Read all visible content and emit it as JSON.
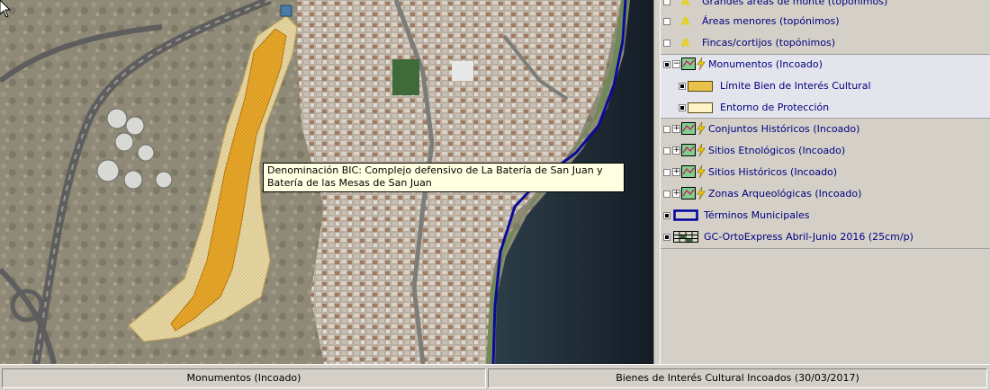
{
  "map": {
    "tooltip": "Denominación BIC: Complejo defensivo de La Batería de San Juan y Batería de las Mesas de San Juan"
  },
  "layers": [
    {
      "label": "Grandes áreas de monte (topónimos)",
      "icon": "font-a-icon",
      "checked": false
    },
    {
      "label": "Áreas menores (topónimos)",
      "icon": "font-a-icon",
      "checked": false
    },
    {
      "label": "Fincas/cortijos (topónimos)",
      "icon": "font-a-icon",
      "checked": false
    },
    {
      "label": "Monumentos (Incoado)",
      "icon": "polygon-layer-icon",
      "checked": true,
      "expanded": true
    },
    {
      "label": "Límite Bien de Interés Cultural",
      "icon": "legend-swatch-icon",
      "checked": true,
      "swatch": "#e8c24a"
    },
    {
      "label": "Entorno de Protección",
      "icon": "legend-swatch-icon",
      "checked": true,
      "swatch": "#fff4c8"
    },
    {
      "label": "Conjuntos Históricos (Incoado)",
      "icon": "polygon-layer-icon",
      "checked": false
    },
    {
      "label": "Sitios Etnológicos (Incoado)",
      "icon": "polygon-layer-icon",
      "checked": false
    },
    {
      "label": "Sitios Históricos (Incoado)",
      "icon": "polygon-layer-icon",
      "checked": false
    },
    {
      "label": "Zonas Arqueológicas (Incoado)",
      "icon": "polygon-layer-icon",
      "checked": false
    },
    {
      "label": "Términos Municipales",
      "icon": "outline-legend-icon",
      "checked": true
    },
    {
      "label": "GC-OrtoExpress Abril-Junio 2016 (25cm/p)",
      "icon": "raster-layer-icon",
      "checked": true
    }
  ],
  "status": {
    "left": "Monumentos (Incoado)",
    "right": "Bienes de Interés Cultural Incoados (30/03/2017)"
  },
  "colors": {
    "bic": "#e8b63c",
    "entorno": "#e7d7a4",
    "coast": "#0a0a9a",
    "sea": "#1a2a3a"
  }
}
